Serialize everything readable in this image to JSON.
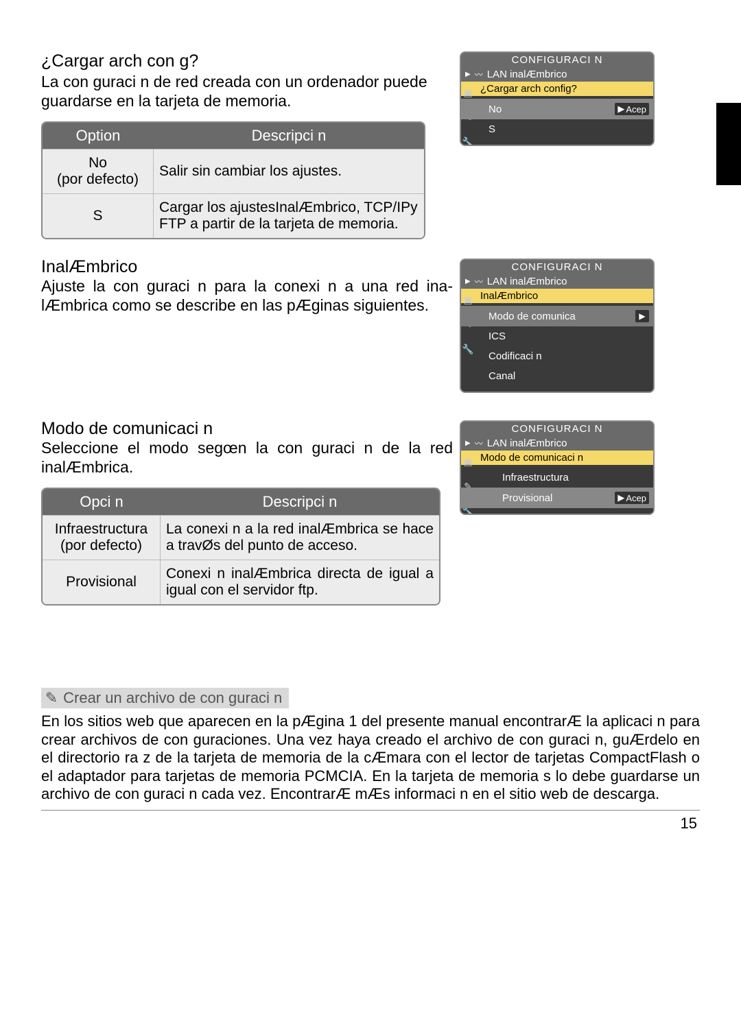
{
  "section1": {
    "heading": "¿Cargar arch con g?",
    "para": "La con guraci n de red creada con un ordenador puede guardarse en la tarjeta de memoria."
  },
  "table1": {
    "head_opt": "Option",
    "head_desc": "Descripci n",
    "row1_opt": "No\n(por defecto)",
    "row1_desc": "Salir sin cambiar los ajustes.",
    "row2_opt": "S",
    "row2_desc": "Cargar los ajustesInalÆmbrico, TCP/IPy FTP a partir de la tarjeta de memoria."
  },
  "panel1": {
    "title": "CONFIGURACI N",
    "sub": "LAN inalÆmbrico",
    "sel": "¿Cargar arch config?",
    "opt_no": "No",
    "opt_si": "S",
    "accept": "Acep"
  },
  "section2": {
    "heading": "InalÆmbrico",
    "para": "Ajuste la con guraci n para la conexi n a una red ina-lÆmbrica como se describe en las pÆginas siguientes."
  },
  "panel2": {
    "title": "CONFIGURACI N",
    "sub": "LAN inalÆmbrico",
    "sel": "InalÆmbrico",
    "items": [
      "Modo de comunica",
      "ICS",
      "Codificaci n",
      "Canal"
    ]
  },
  "section3": {
    "heading": "Modo de comunicaci n",
    "para": "Seleccione el modo segœn la con guraci n de la red inalÆmbrica."
  },
  "table2": {
    "head_opt": "Opci n",
    "head_desc": "Descripci n",
    "row1_opt": "Infraestructura\n(por defecto)",
    "row1_desc": "La conexi n a la red inalÆmbrica se hace a travØs del punto de acceso.",
    "row2_opt": "Provisional",
    "row2_desc": "Conexi n inalÆmbrica directa de igual a igual con el servidor ftp."
  },
  "panel3": {
    "title": "CONFIGURACI N",
    "sub": "LAN inalÆmbrico",
    "sel": "Modo de comunicaci n",
    "opt_infra": "Infraestructura",
    "opt_prov": "Provisional",
    "accept": "Acep"
  },
  "footnote": {
    "title": "Crear un archivo de con guraci n",
    "body": "En los sitios web que aparecen en la pÆgina 1 del presente manual encontrarÆ la aplicaci n para crear archivos de con guraciones. Una vez haya creado el archivo de con guraci n, guÆrdelo en el directorio ra z de la tarjeta de memoria de la cÆmara con el lector de tarjetas CompactFlash o el adaptador para tarjetas de memoria PCMCIA. En la tarjeta de memoria s lo debe guardarse un archivo de con guraci n cada vez. EncontrarÆ mÆs informaci n en el sitio web de descarga."
  },
  "page_number": "15"
}
